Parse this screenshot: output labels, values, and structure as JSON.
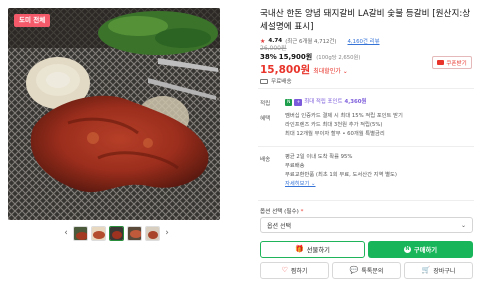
{
  "image": {
    "badge": "도미 전체",
    "thumbnail_count": 5
  },
  "product": {
    "title": "국내산 한돈 양념 돼지갈비 LA갈비 숯불 등갈비 [원산지:상세설명에 표시]",
    "rating": "4.74",
    "rating_count": "(최근 6개월 4,712건)",
    "reviews_link": "4,160건 리뷰"
  },
  "price": {
    "original": "26,000원",
    "discount_pct": "38%",
    "sale_price": "15,900원",
    "unit_price": "(100g당 2,650원)",
    "max_discount_price": "15,800원",
    "max_discount_label": "최대할인가 ⌄",
    "coupon_button": "쿠폰받기",
    "shipping": "무료배송"
  },
  "benefits": {
    "points_label": "적립",
    "points_text": "최대 적립 포인트",
    "points_value": "4,360원",
    "card_label": "혜택",
    "card_lines": [
      "멤버십 인증카드 결제 시 최대 15% 적립 포인트 받기",
      "라인프렌즈 카드 최대 3천원 추가 적립(5%)",
      "최대 12개월 무이자 할부 • 60개월 특별금리"
    ],
    "delivery_label": "배송",
    "delivery_lines": [
      "평균 2일 이내 도착 확률 95%",
      "무료배송",
      "무료교환반품 (최초 1회 무료, 도서산간 지역 별도)"
    ],
    "detail_link": "자세히보기 ⌄"
  },
  "options": {
    "label": "옵션 선택 (필수)",
    "required_mark": "*",
    "select_value": "옵션 선택"
  },
  "actions": {
    "gift": "선물하기",
    "buy": "구매하기",
    "like": "찜하기",
    "talk": "톡톡문의",
    "cart": "장바구니"
  },
  "colors": {
    "accent_green": "#19b55a",
    "price_red": "#e8342b",
    "points_purple": "#7c5cdb"
  }
}
